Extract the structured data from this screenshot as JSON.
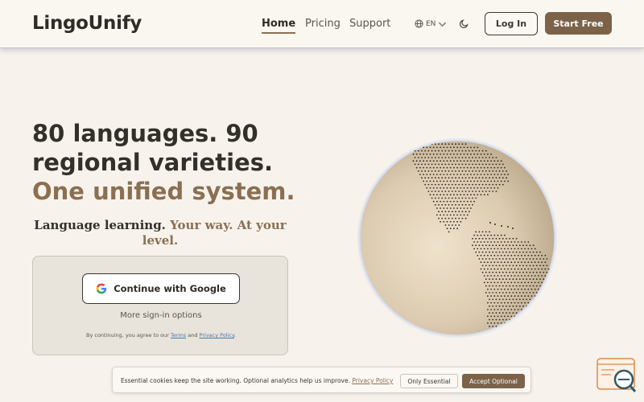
{
  "header": {
    "logo": "LingoUnify",
    "nav": [
      "Home",
      "Pricing",
      "Support"
    ],
    "language": "EN",
    "login_label": "Log In",
    "start_label": "Start Free"
  },
  "hero": {
    "headline": "80 languages. 90 regional varieties.",
    "headline_accent": "One unified system.",
    "subtitle_plain": "Language learning.",
    "subtitle_accent": "Your way. At your level."
  },
  "signin": {
    "google_label": "Continue with Google",
    "more_options": "More sign-in options",
    "terms_prefix": "By continuing, you agree to our",
    "terms_link": "Terms",
    "terms_and": "and",
    "privacy_link": "Privacy Policy",
    "terms_suffix": "."
  },
  "cookie": {
    "text": "Essential cookies keep the site working. Optional analytics help us improve.",
    "policy_link": "Privacy Policy",
    "essential_label": "Only Essential",
    "accept_label": "Accept Optional"
  },
  "colors": {
    "accent": "#8a6f52",
    "button_dark": "#7b6249",
    "background": "#f7f3ec"
  },
  "icons": [
    "globe-icon",
    "moon-icon",
    "google-icon",
    "chat-search-widget-icon"
  ]
}
